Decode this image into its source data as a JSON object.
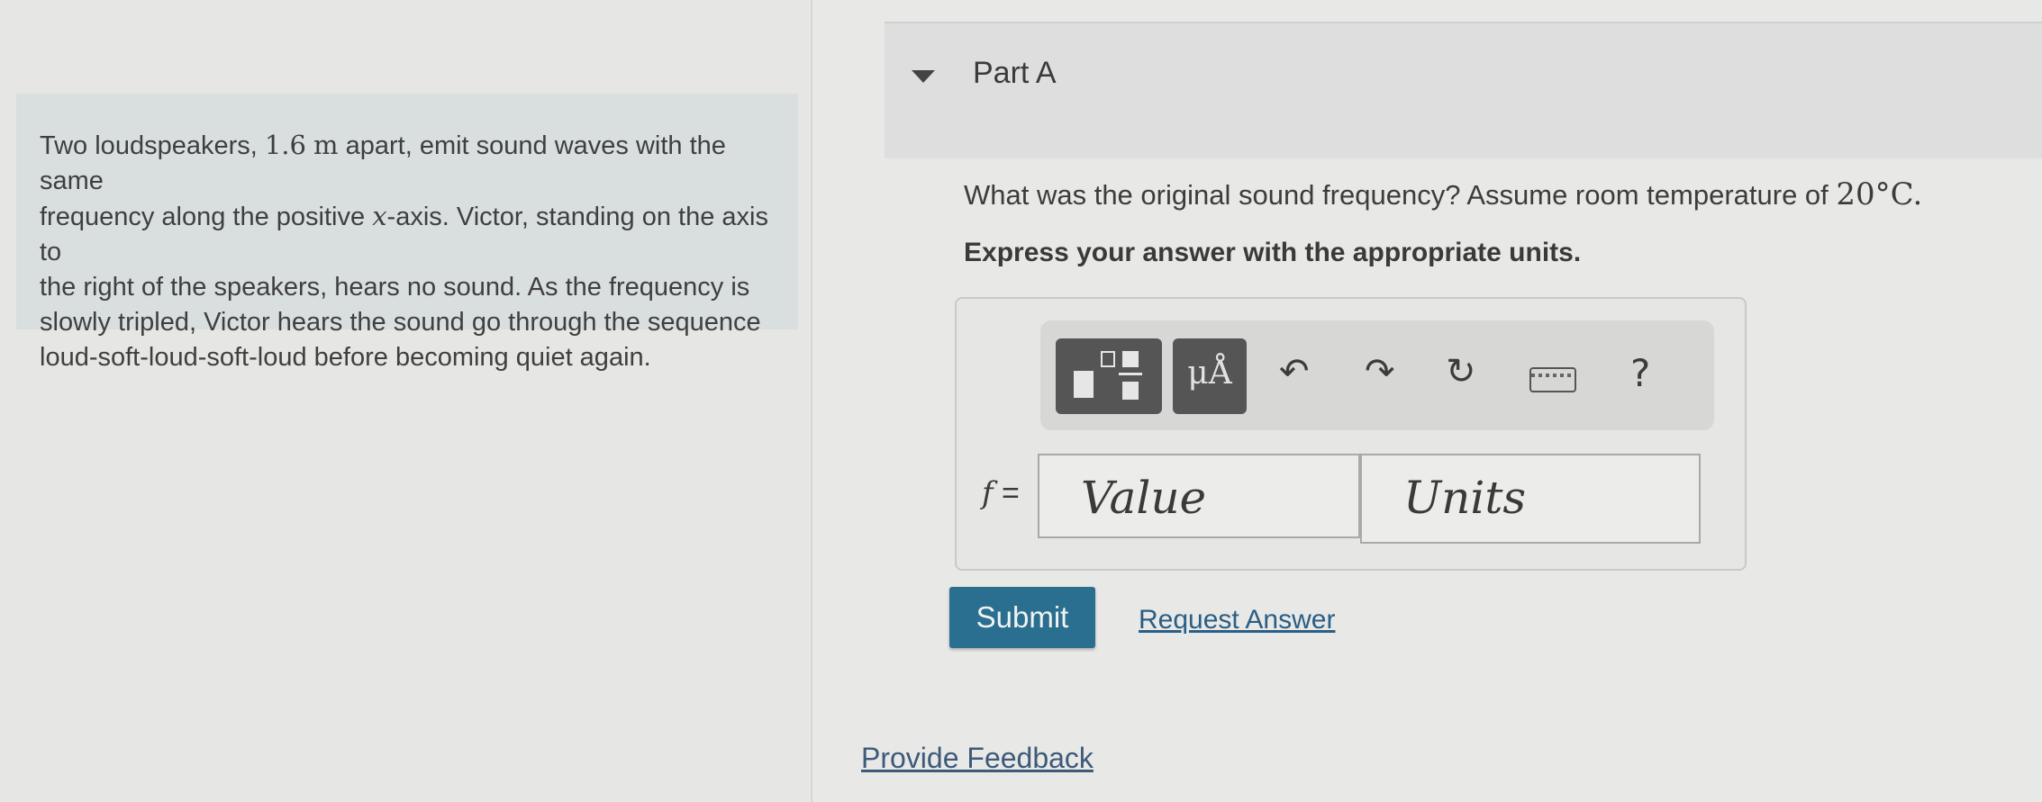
{
  "problem": {
    "line1_pre": "Two loudspeakers, ",
    "distance_value": "1.6",
    "distance_unit": "m",
    "line1_post": " apart, emit sound waves with the same",
    "line2_pre": "frequency along the positive ",
    "axis_var": "x",
    "line2_post": "-axis. Victor, standing on the axis to",
    "line3": "the right of the speakers, hears no sound. As the frequency is",
    "line4": "slowly tripled, Victor hears the sound go through the sequence",
    "line5": "loud-soft-loud-soft-loud before becoming quiet again."
  },
  "part": {
    "title": "Part A"
  },
  "question": {
    "text": "What was the original sound frequency? Assume room temperature of ",
    "temperature": "20°C."
  },
  "instruction": "Express your answer with the appropriate units.",
  "toolbar": {
    "units_symbol": "μÅ",
    "help": "?",
    "undo_glyph": "↶",
    "redo_glyph": "↷",
    "reset_glyph": "↻"
  },
  "answer": {
    "label_var": "f",
    "label_eq": " =",
    "value_placeholder": "Value",
    "units_placeholder": "Units"
  },
  "actions": {
    "submit": "Submit",
    "request_answer": "Request Answer"
  },
  "footer": {
    "provide_feedback": "Provide Feedback"
  }
}
